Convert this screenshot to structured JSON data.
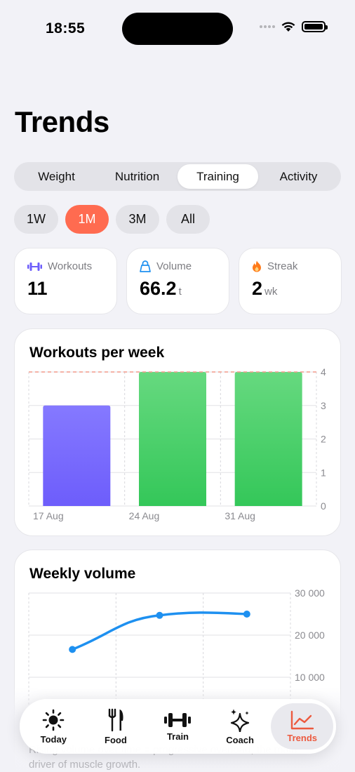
{
  "status_bar": {
    "time": "18:55"
  },
  "page": {
    "title": "Trends"
  },
  "segments": [
    {
      "label": "Weight",
      "active": false
    },
    {
      "label": "Nutrition",
      "active": false
    },
    {
      "label": "Training",
      "active": true
    },
    {
      "label": "Activity",
      "active": false
    }
  ],
  "ranges": [
    {
      "label": "1W",
      "active": false
    },
    {
      "label": "1M",
      "active": true
    },
    {
      "label": "3M",
      "active": false
    },
    {
      "label": "All",
      "active": false
    }
  ],
  "stats": [
    {
      "label": "Workouts",
      "value": "11",
      "unit": "",
      "icon": "dumbbell-icon"
    },
    {
      "label": "Volume",
      "value": "66.2",
      "unit": "t",
      "icon": "kettlebell-icon"
    },
    {
      "label": "Streak",
      "value": "2",
      "unit": "wk",
      "icon": "flame-icon"
    }
  ],
  "colors": {
    "accent": "#ff6b50",
    "bar_purple": "#6d5dfb",
    "bar_green": "#34c759",
    "line_blue": "#1e90f0",
    "tab_active": "#ec5a3f"
  },
  "chart_data": [
    {
      "type": "bar",
      "title": "Workouts per week",
      "categories": [
        "17 Aug",
        "24 Aug",
        "31 Aug"
      ],
      "values": [
        3,
        4,
        4
      ],
      "ylim": [
        0,
        4
      ],
      "yticks": [
        "0",
        "1",
        "2",
        "3",
        "4"
      ],
      "goal_line": 4,
      "grid": true
    },
    {
      "type": "line",
      "title": "Weekly volume",
      "values": [
        16600,
        24700,
        25000
      ],
      "ylim": [
        0,
        30000
      ],
      "yticks": [
        "10 000",
        "20 000",
        "30 000"
      ],
      "grid": true
    }
  ],
  "footer_text": "Rising volume over time = progressive overload, the main driver of muscle growth.",
  "tabbar": [
    {
      "label": "Today",
      "icon": "sun-icon",
      "active": false
    },
    {
      "label": "Food",
      "icon": "fork-knife-icon",
      "active": false
    },
    {
      "label": "Train",
      "icon": "dumbbell-icon",
      "active": false
    },
    {
      "label": "Coach",
      "icon": "sparkles-icon",
      "active": false
    },
    {
      "label": "Trends",
      "icon": "chart-icon",
      "active": true
    }
  ]
}
